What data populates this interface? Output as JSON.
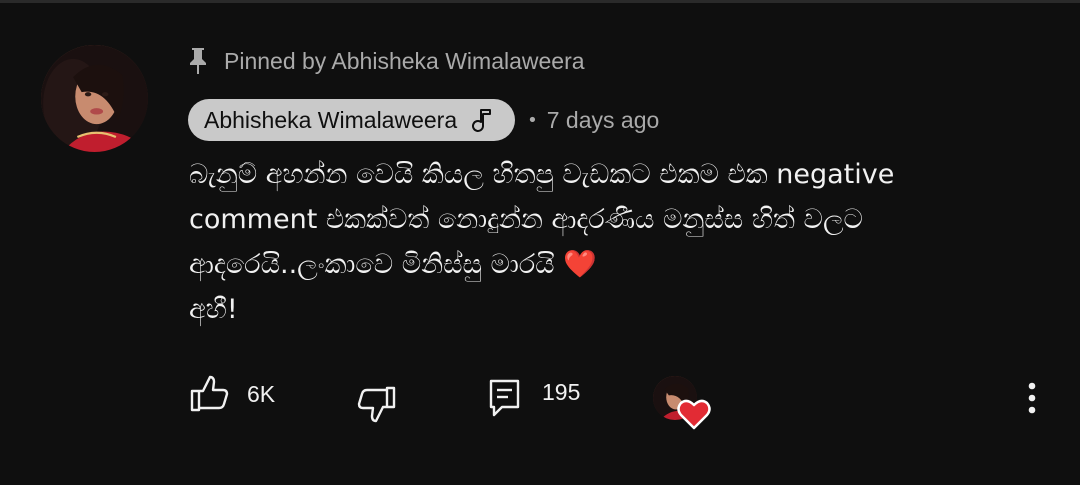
{
  "pinned": {
    "icon": "pin-icon",
    "text": "Pinned by Abhisheka Wimalaweera"
  },
  "comment": {
    "author": "Abhisheka Wimalaweera",
    "author_badge_icon": "music-note-icon",
    "separator": "•",
    "time": "7 days ago",
    "lines": [
      "බැනුම් අහන්න වෙයි කියල හිතපු  වැඩකට එකම එක negative",
      "comment එකක්වත් නොදුන්න ආදරණීය මනුස්ස හිත් වලට",
      "ආදරෙයි..ලංකාවෙ මිනිස්සු මාරයි ❤️",
      "අහී!"
    ]
  },
  "actions": {
    "like_count": "6K",
    "reply_count": "195",
    "creator_heart": "creator-heart-icon",
    "more": "more-vert-icon"
  },
  "colors": {
    "background": "#0f0f0f",
    "primary_text": "#f1f1f1",
    "secondary_text": "#aaaaaa",
    "author_chip": "#c9c9c9",
    "heart": "#e22b34"
  }
}
